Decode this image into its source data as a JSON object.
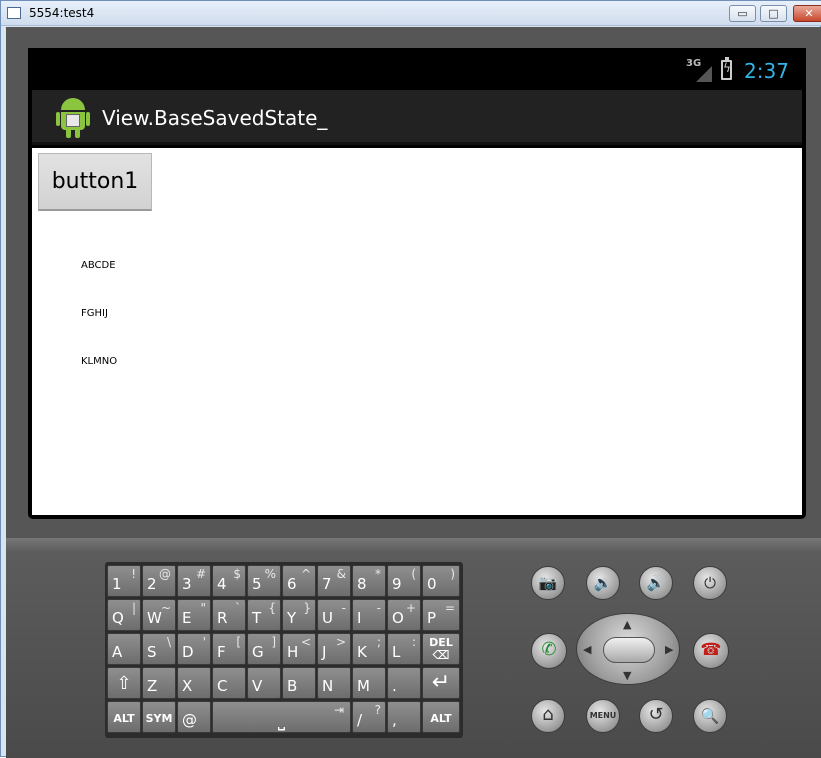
{
  "window": {
    "title": "5554:test4",
    "controls": {
      "minimize": "▭",
      "maximize": "□",
      "close": "✕"
    }
  },
  "statusbar": {
    "network": "3G",
    "time": "2:37",
    "time_color": "#33b5e5"
  },
  "actionbar": {
    "app_name": "View.BaseSavedState_",
    "icon": "android-robot-icon"
  },
  "content": {
    "button1_label": "button1",
    "labels": [
      "ABCDE",
      "FGHIJ",
      "KLMNO"
    ]
  },
  "keyboard": {
    "row1": [
      {
        "main": "1",
        "alt": "!"
      },
      {
        "main": "2",
        "alt": "@"
      },
      {
        "main": "3",
        "alt": "#"
      },
      {
        "main": "4",
        "alt": "$"
      },
      {
        "main": "5",
        "alt": "%"
      },
      {
        "main": "6",
        "alt": "^"
      },
      {
        "main": "7",
        "alt": "&"
      },
      {
        "main": "8",
        "alt": "*"
      },
      {
        "main": "9",
        "alt": "("
      },
      {
        "main": "0",
        "alt": ")"
      }
    ],
    "row2": [
      {
        "main": "Q",
        "alt": "|"
      },
      {
        "main": "W",
        "alt": "~"
      },
      {
        "main": "E",
        "alt": "\""
      },
      {
        "main": "R",
        "alt": "`"
      },
      {
        "main": "T",
        "alt": "{"
      },
      {
        "main": "Y",
        "alt": "}"
      },
      {
        "main": "U",
        "alt": "-"
      },
      {
        "main": "I",
        "alt": "-"
      },
      {
        "main": "O",
        "alt": "+"
      },
      {
        "main": "P",
        "alt": "="
      }
    ],
    "row3": [
      {
        "main": "A",
        "alt": ""
      },
      {
        "main": "S",
        "alt": "\\"
      },
      {
        "main": "D",
        "alt": "'"
      },
      {
        "main": "F",
        "alt": "["
      },
      {
        "main": "G",
        "alt": "]"
      },
      {
        "main": "H",
        "alt": "<"
      },
      {
        "main": "J",
        "alt": ">"
      },
      {
        "main": "K",
        "alt": ";"
      },
      {
        "main": "L",
        "alt": ":"
      },
      {
        "main": "DEL",
        "alt": ""
      }
    ],
    "row4": [
      {
        "main": "⇧",
        "alt": ""
      },
      {
        "main": "Z",
        "alt": ""
      },
      {
        "main": "X",
        "alt": ""
      },
      {
        "main": "C",
        "alt": ""
      },
      {
        "main": "V",
        "alt": ""
      },
      {
        "main": "B",
        "alt": ""
      },
      {
        "main": "N",
        "alt": ""
      },
      {
        "main": "M",
        "alt": ""
      },
      {
        "main": ".",
        "alt": ""
      },
      {
        "main": "↵",
        "alt": ""
      }
    ],
    "row5": {
      "alt_left": "ALT",
      "sym": "SYM",
      "at": "@",
      "space": "⎵",
      "space_alt": "⇥",
      "slash_main": "/",
      "slash_alt": "?",
      "comma": ",",
      "alt_right": "ALT"
    }
  },
  "controls": {
    "camera": "📷",
    "vol_down": "🔉",
    "vol_up": "🔊",
    "power": "⏻",
    "call": "✆",
    "end_call": "☎",
    "home": "⌂",
    "menu": "MENU",
    "back": "↺",
    "search": "🔍",
    "dpad_up": "▲",
    "dpad_down": "▼",
    "dpad_left": "◀",
    "dpad_right": "▶"
  }
}
